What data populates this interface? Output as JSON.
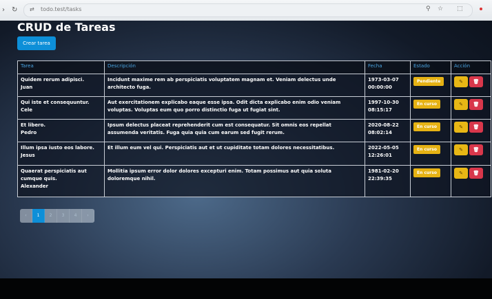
{
  "browser": {
    "url": "todo.test/tasks",
    "back_icon": "arrow-left-icon",
    "reload_icon": "reload-icon"
  },
  "page": {
    "title": "CRUD de Tareas",
    "create_label": "Crear tarea"
  },
  "table": {
    "headers": [
      "Tarea",
      "Descripción",
      "Fecha",
      "Estado",
      "Acción"
    ],
    "rows": [
      {
        "task": "Quidem rerum adipisci.",
        "user": "Juan",
        "description": "Incidunt maxime rem ab perspiciatis voluptatem magnam et. Veniam delectus unde architecto fuga.",
        "date": "1973-03-07",
        "time": "00:00:00",
        "status": "Pendiente"
      },
      {
        "task": "Qui iste et consequuntur.",
        "user": "Cele",
        "description": "Aut exercitationem explicabo eaque esse ipsa. Odit dicta explicabo enim odio veniam voluptas. Voluptas eum quo porro distinctio fuga ut fugiat sint.",
        "date": "1997-10-30",
        "time": "08:15:17",
        "status": "En curso"
      },
      {
        "task": "Et libero.",
        "user": "Pedro",
        "description": "Ipsum delectus placeat reprehenderit cum est consequatur. Sit omnis eos repellat assumenda veritatis. Fuga quia quia cum earum sed fugit rerum.",
        "date": "2020-08-22",
        "time": "08:02:14",
        "status": "En curso"
      },
      {
        "task": "Illum ipsa iusto eos labore.",
        "user": "Jesus",
        "description": "Et illum eum vel qui. Perspiciatis aut et ut cupiditate totam dolores necessitatibus.",
        "date": "2022-05-05",
        "time": "12:26:01",
        "status": "En curso"
      },
      {
        "task": "Quaerat perspiciatis aut cumque quis.",
        "user": "Alexander",
        "description": "Mollitia ipsum error dolor dolores excepturi enim. Totam possimus aut quia soluta doloremque nihil.",
        "date": "1981-02-20",
        "time": "22:39:35",
        "status": "En curso"
      }
    ],
    "edit_icon": "pencil-icon",
    "delete_icon": "trash-icon"
  },
  "pagination": {
    "prev": "‹",
    "pages": [
      "1",
      "2",
      "3",
      "4"
    ],
    "next": "›",
    "active_page": "1"
  },
  "colors": {
    "primary": "#0d8fd8",
    "warning": "#e6b214",
    "danger": "#d8374b",
    "header_text": "#4aa3e0"
  }
}
